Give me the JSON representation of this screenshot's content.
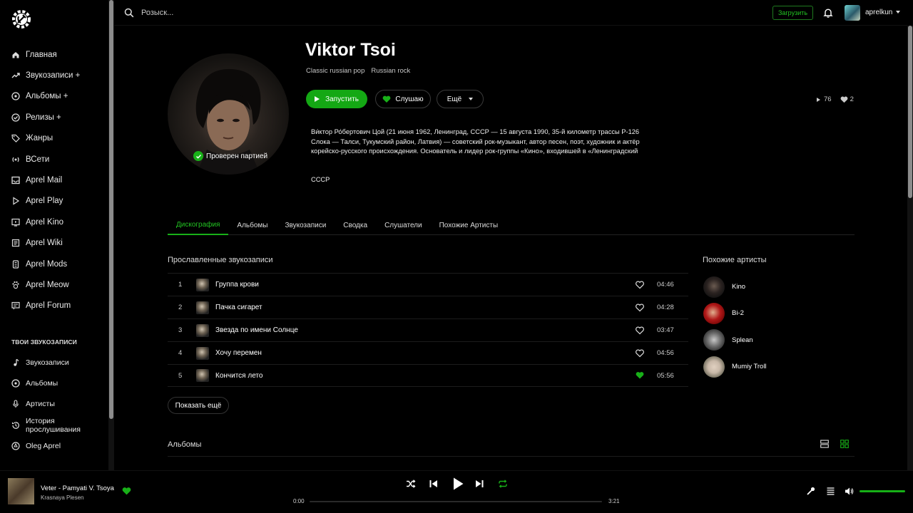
{
  "sidebar": {
    "logo_icon": "hammer-sickle-gear-icon",
    "items": [
      {
        "label": "Главная",
        "icon": "home-icon"
      },
      {
        "label": "Звукозаписи +",
        "icon": "trend-icon"
      },
      {
        "label": "Альбомы +",
        "icon": "disc-icon"
      },
      {
        "label": "Релизы +",
        "icon": "check-circle-icon"
      },
      {
        "label": "Жанры",
        "icon": "tag-icon"
      },
      {
        "label": "ВСети",
        "icon": "broadcast-icon"
      },
      {
        "label": "Aprel Mail",
        "icon": "mail-icon"
      },
      {
        "label": "Aprel Play",
        "icon": "play-icon"
      },
      {
        "label": "Aprel Kino",
        "icon": "tv-icon"
      },
      {
        "label": "Aprel Wiki",
        "icon": "book-icon"
      },
      {
        "label": "Aprel Mods",
        "icon": "mods-icon"
      },
      {
        "label": "Aprel Meow",
        "icon": "paw-icon"
      },
      {
        "label": "Aprel Forum",
        "icon": "forum-icon"
      }
    ],
    "section_title": "ТВОИ ЗВУКОЗАПИСИ",
    "library": [
      {
        "label": "Звукозаписи",
        "icon": "note-icon"
      },
      {
        "label": "Альбомы",
        "icon": "disc-icon"
      },
      {
        "label": "Артисты",
        "icon": "mic-icon"
      },
      {
        "label": "История прослушивания",
        "icon": "history-icon"
      },
      {
        "label": "Oleg Aprel",
        "icon": "user-circle-icon"
      }
    ]
  },
  "topbar": {
    "search_placeholder": "Розыск...",
    "upload_label": "Загрузить",
    "username": "aprelkun"
  },
  "artist": {
    "name": "Viktor Tsoi",
    "genres": [
      "Classic russian pop",
      "Russian rock"
    ],
    "verified_label": "Проверен партией",
    "play_label": "Запустить",
    "listen_label": "Слушаю",
    "more_label": "Ещё",
    "plays": "76",
    "likes": "2",
    "bio_lines": [
      "Ви́ктор Ро́бертович Цой (21 июня 1962, Ленинград, СССР — 15 августа 1990, 35-й километр трассы Р-126",
      "Слока — Талси, Тукумский район, Латвия) — советский рок-музыкант, автор песен, поэт, художник и актёр",
      "корейско-русского происхождения. Основатель и лидер рок-группы «Кино», входившей в «Ленинградский"
    ],
    "country": "СССР"
  },
  "tabs": [
    "Дискография",
    "Альбомы",
    "Звукозаписи",
    "Сводка",
    "Слушатели",
    "Похожие Артисты"
  ],
  "popular": {
    "title": "Прославленные звукозаписи",
    "tracks": [
      {
        "num": "1",
        "title": "Группа крови",
        "duration": "04:46",
        "liked": false
      },
      {
        "num": "2",
        "title": "Пачка сигарет",
        "duration": "04:28",
        "liked": false
      },
      {
        "num": "3",
        "title": "Звезда по имени Солнце",
        "duration": "03:47",
        "liked": false
      },
      {
        "num": "4",
        "title": "Хочу перемен",
        "duration": "04:56",
        "liked": false
      },
      {
        "num": "5",
        "title": "Кончится лето",
        "duration": "05:56",
        "liked": true
      }
    ],
    "show_more": "Показать ещё"
  },
  "albums_title": "Альбомы",
  "similar": {
    "title": "Похожие артисты",
    "artists": [
      {
        "name": "Kino",
        "color": "#2a2220"
      },
      {
        "name": "Bi-2",
        "color": "#b01818"
      },
      {
        "name": "Splean",
        "color": "#6a6a6a"
      },
      {
        "name": "Mumiy Troll",
        "color": "#c8b8a8"
      }
    ]
  },
  "player": {
    "title": "Veter - Pamyati V. Tsoya",
    "artist": "Krasnaya Plesen",
    "time_current": "0:00",
    "time_total": "3:21",
    "progress": 0,
    "volume": 1.0
  },
  "colors": {
    "accent": "#18b018",
    "background": "#000000"
  }
}
